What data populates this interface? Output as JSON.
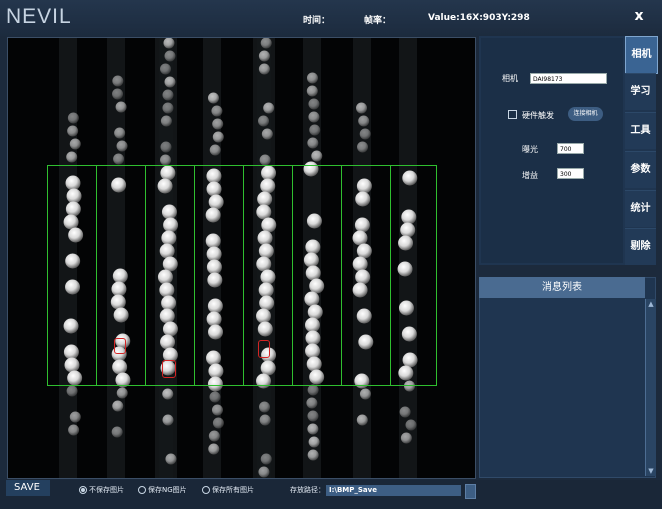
{
  "app": {
    "logo": "NEVIL",
    "time_label": "时间：",
    "fps_label": "帧率：",
    "value_readout": "Value:16X:903Y:298",
    "close_glyph": "x"
  },
  "tabs": [
    {
      "label": "相机",
      "active": true
    },
    {
      "label": "学习"
    },
    {
      "label": "工具"
    },
    {
      "label": "参数"
    },
    {
      "label": "统计"
    },
    {
      "label": "剔除"
    }
  ],
  "camera": {
    "camera_label": "相机",
    "camera_value": "DAI98173",
    "hw_trigger_label": "硬件触发",
    "hw_trigger_checked": false,
    "connect_button": "连接相机",
    "exposure_label": "曝光",
    "exposure_value": "700",
    "gain_label": "增益",
    "gain_value": "300"
  },
  "messages": {
    "title": "消息列表",
    "items": []
  },
  "bottom": {
    "save_label": "SAVE",
    "options": [
      {
        "label": "不保存图片",
        "selected": true
      },
      {
        "label": "保存NG图片",
        "selected": false
      },
      {
        "label": "保存所有图片",
        "selected": false
      }
    ],
    "path_label": "存放路径：",
    "path_value": "I:\\BMP_Save"
  },
  "colors": {
    "roi": "#2fbf2f",
    "defect": "#d42424",
    "active_tab": "#3a6493",
    "background": "#1c2a3c"
  }
}
